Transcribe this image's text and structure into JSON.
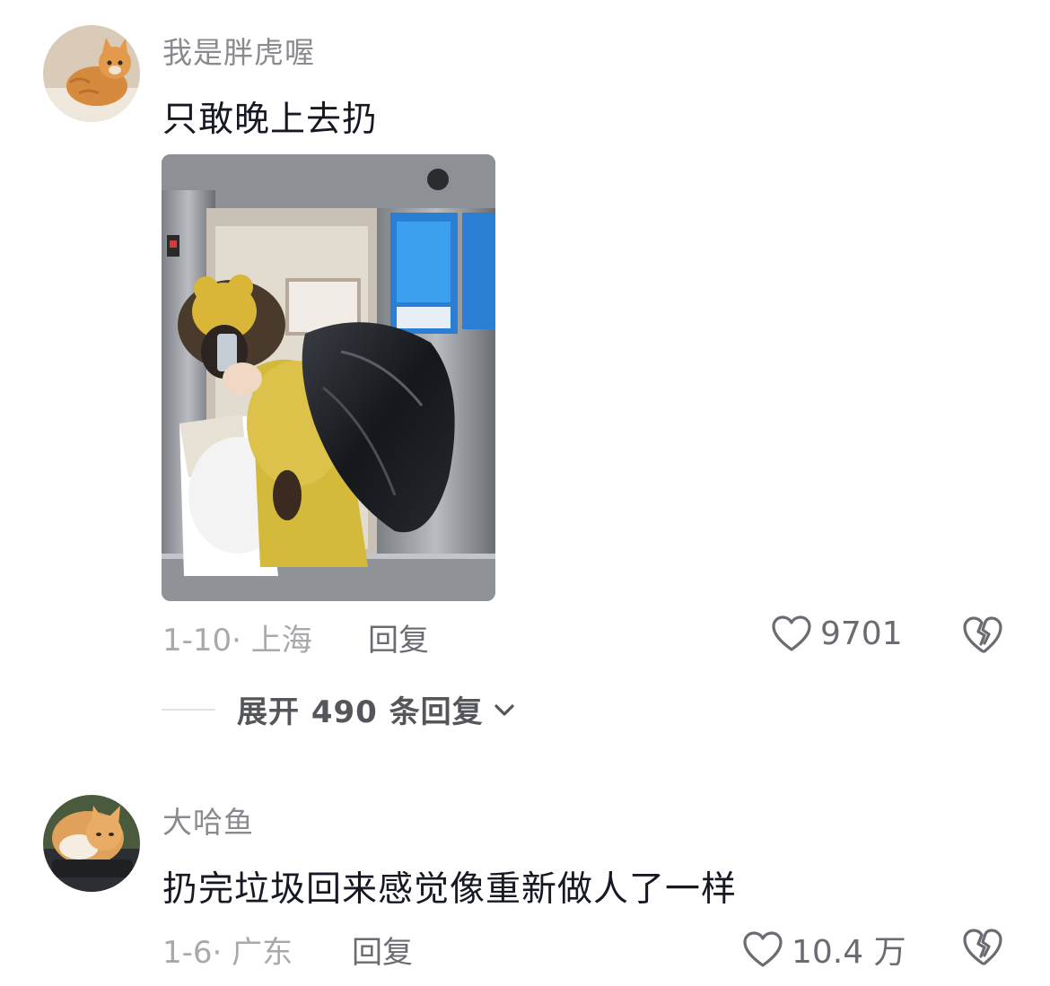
{
  "comments": [
    {
      "username": "我是胖虎喔",
      "text": "只敢晚上去扔",
      "avatar_icon": "orange-cat-avatar",
      "has_image": true,
      "image_subject": "person-in-bear-costume-carrying-trash-bag-elevator-photo",
      "date": "1-10",
      "location": "上海",
      "reply_label": "回复",
      "likes": "9701",
      "expand_label": "展开 490 条回复"
    },
    {
      "username": "大哈鱼",
      "text": "扔完垃圾回来感觉像重新做人了一样",
      "avatar_icon": "ginger-cat-avatar",
      "date": "1-6",
      "location": "广东",
      "reply_label": "回复",
      "likes": "10.4 万"
    }
  ],
  "meta_separator": "·",
  "colors": {
    "username": "#8a8b91",
    "text": "#161823",
    "meta": "#a8a9ad",
    "action": "#6b6c73"
  }
}
